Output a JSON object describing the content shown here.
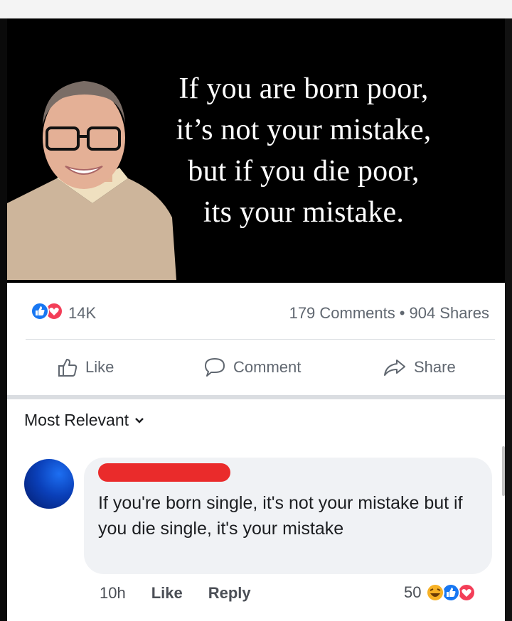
{
  "quote": {
    "lines": [
      "If you are born poor,",
      "it’s not your mistake,",
      "but if you die poor,",
      "its your mistake."
    ]
  },
  "post_stats": {
    "reaction_count": "14K",
    "comments": "179 Comments",
    "separator": "•",
    "shares": "904 Shares",
    "reaction_icons": [
      "like-icon",
      "love-icon"
    ]
  },
  "actions": {
    "like": "Like",
    "comment": "Comment",
    "share": "Share"
  },
  "comments_section": {
    "sort_label": "Most Relevant",
    "comment": {
      "text": "If you're born single, it's not your mistake but if you die single, it's your mistake",
      "time": "10h",
      "like": "Like",
      "reply": "Reply",
      "reaction_count": "50",
      "reaction_icons": [
        "haha-icon",
        "like-icon",
        "love-icon"
      ]
    }
  },
  "colors": {
    "like_blue": "#1877f2",
    "love_red": "#f33e58",
    "haha_yellow": "#f7b125",
    "redaction": "#ea2b2b"
  }
}
